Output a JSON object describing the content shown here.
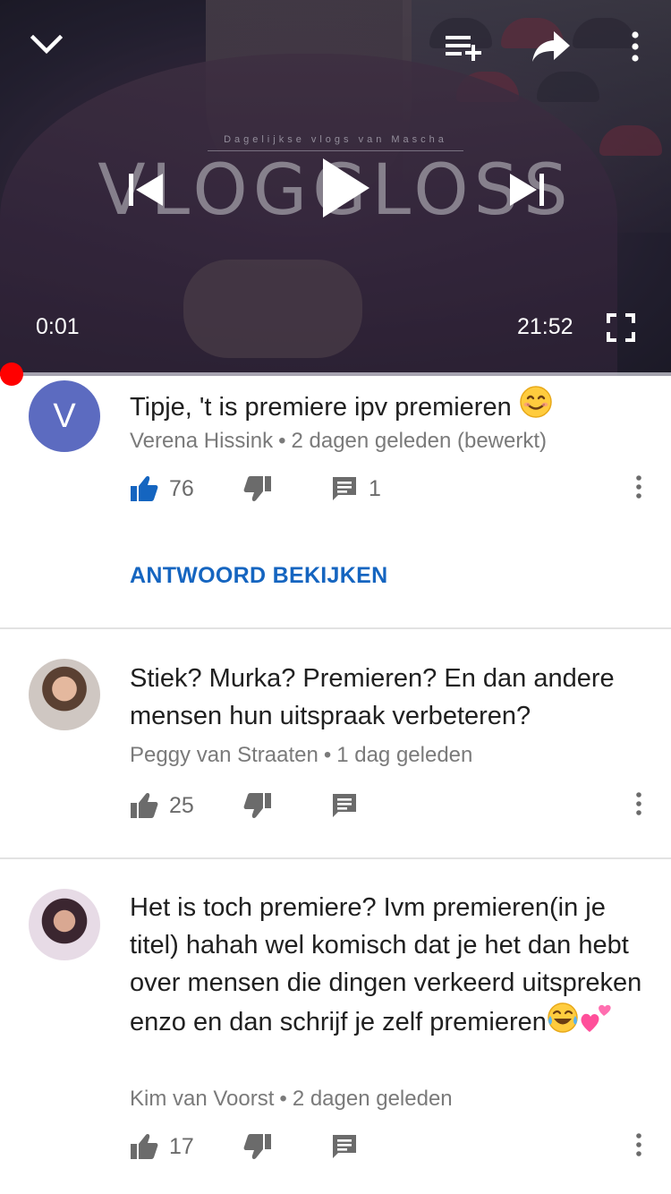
{
  "player": {
    "overlay_tagline": "Dagelijkse vlogs van Mascha",
    "overlay_title": "VLOGGLOSS",
    "current_time": "0:01",
    "duration": "21:52",
    "progress_fraction": 0.0008,
    "progress_color": "#ff0000",
    "icons": {
      "collapse": "chevron-down-icon",
      "add_to_queue": "add-to-queue-icon",
      "share": "share-icon",
      "more": "more-vertical-icon",
      "previous": "skip-previous-icon",
      "play": "play-icon",
      "next": "skip-next-icon",
      "fullscreen": "fullscreen-icon"
    }
  },
  "comments": [
    {
      "avatar_letter": "V",
      "avatar_color": "#5c6bc0",
      "text": "Tipje, 't is premiere ipv premieren",
      "text_emoji": "smiling-face-emoji",
      "author": "Verena Hissink",
      "time": "2 dagen geleden (bewerkt)",
      "likes": "76",
      "liked": true,
      "replies": "1",
      "view_replies_label": "ANTWOORD BEKIJKEN"
    },
    {
      "text": "Stiek? Murka? Premieren? En dan andere mensen hun uitspraak verbeteren?",
      "author": "Peggy van Straaten",
      "time": "1 dag geleden",
      "likes": "25",
      "liked": false
    },
    {
      "text": "Het is toch premiere? Ivm premieren(in je titel) hahah wel komisch dat je het dan hebt over mensen die dingen verkeerd uitspreken enzo en dan schrijf je zelf premieren",
      "text_emoji": [
        "tears-of-joy-emoji",
        "two-hearts-emoji"
      ],
      "author": "Kim van Voorst",
      "time": "2 dagen geleden",
      "likes": "17",
      "liked": false
    }
  ],
  "colors": {
    "accent_blue": "#1565c0",
    "like_active": "#1565c0",
    "icon_gray": "#6b6b6b",
    "meta_gray": "#7a7a7a"
  }
}
